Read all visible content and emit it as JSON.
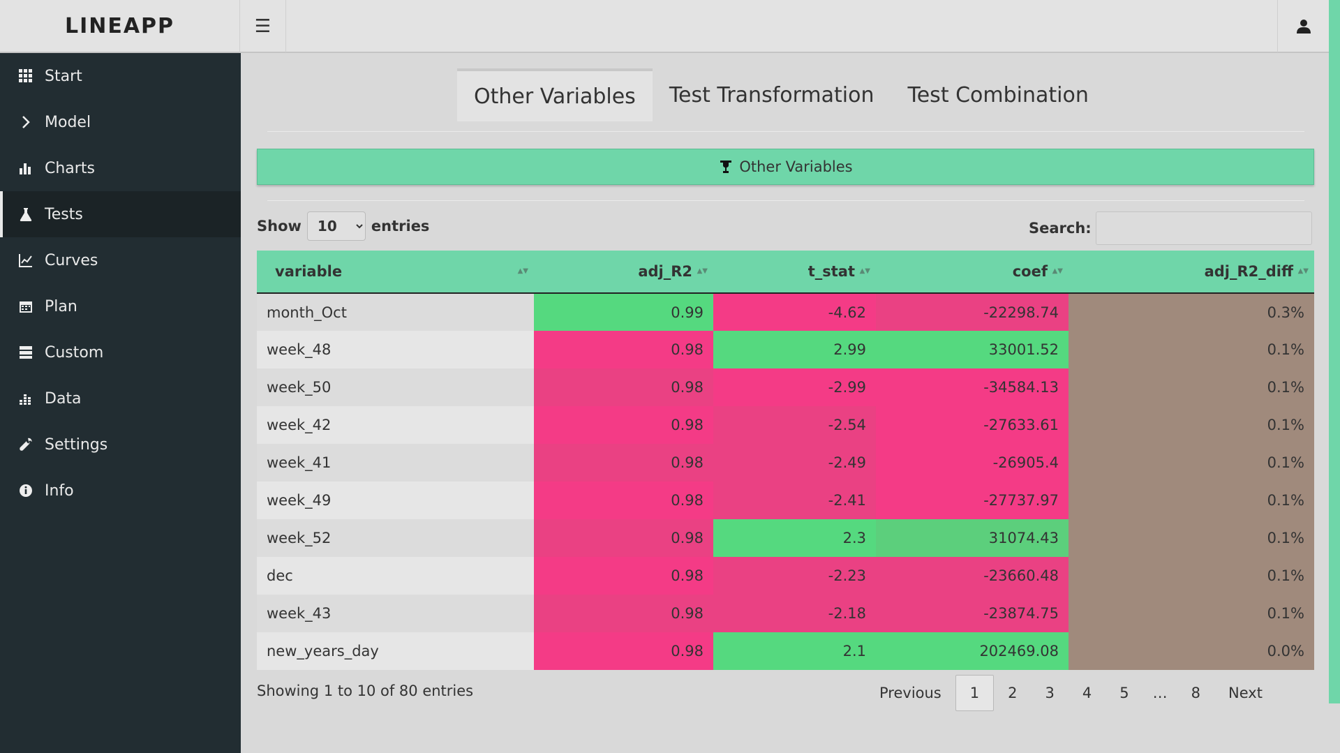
{
  "app": {
    "brand": "LINEAPP"
  },
  "header": {
    "menu_icon": "hamburger-icon",
    "user_icon": "user-icon"
  },
  "sidebar": {
    "items": [
      {
        "label": "Start",
        "icon": "grid-icon"
      },
      {
        "label": "Model",
        "icon": "chevron-right-icon"
      },
      {
        "label": "Charts",
        "icon": "bar-chart-icon"
      },
      {
        "label": "Tests",
        "icon": "flask-icon",
        "active": true
      },
      {
        "label": "Curves",
        "icon": "line-chart-icon"
      },
      {
        "label": "Plan",
        "icon": "calendar-icon"
      },
      {
        "label": "Custom",
        "icon": "server-icon"
      },
      {
        "label": "Data",
        "icon": "data-bars-icon"
      },
      {
        "label": "Settings",
        "icon": "wrench-icon"
      },
      {
        "label": "Info",
        "icon": "info-icon"
      }
    ]
  },
  "tabs": [
    "Other Variables",
    "Test Transformation",
    "Test Combination"
  ],
  "banner": {
    "label": "Other Variables",
    "icon": "trophy-icon"
  },
  "controls": {
    "show_label": "Show",
    "entries_label": "entries",
    "page_size": "10",
    "search_label": "Search:",
    "search_value": ""
  },
  "table": {
    "headers": [
      "variable",
      "adj_R2",
      "t_stat",
      "coef",
      "adj_R2_diff"
    ],
    "rows": [
      {
        "variable": "month_Oct",
        "adj_R2": "0.99",
        "t_stat": "-4.62",
        "coef": "-22298.74",
        "adj_R2_diff": "0.3%"
      },
      {
        "variable": "week_48",
        "adj_R2": "0.98",
        "t_stat": "2.99",
        "coef": "33001.52",
        "adj_R2_diff": "0.1%"
      },
      {
        "variable": "week_50",
        "adj_R2": "0.98",
        "t_stat": "-2.99",
        "coef": "-34584.13",
        "adj_R2_diff": "0.1%"
      },
      {
        "variable": "week_42",
        "adj_R2": "0.98",
        "t_stat": "-2.54",
        "coef": "-27633.61",
        "adj_R2_diff": "0.1%"
      },
      {
        "variable": "week_41",
        "adj_R2": "0.98",
        "t_stat": "-2.49",
        "coef": "-26905.4",
        "adj_R2_diff": "0.1%"
      },
      {
        "variable": "week_49",
        "adj_R2": "0.98",
        "t_stat": "-2.41",
        "coef": "-27737.97",
        "adj_R2_diff": "0.1%"
      },
      {
        "variable": "week_52",
        "adj_R2": "0.98",
        "t_stat": "2.3",
        "coef": "31074.43",
        "adj_R2_diff": "0.1%"
      },
      {
        "variable": "dec",
        "adj_R2": "0.98",
        "t_stat": "-2.23",
        "coef": "-23660.48",
        "adj_R2_diff": "0.1%"
      },
      {
        "variable": "week_43",
        "adj_R2": "0.98",
        "t_stat": "-2.18",
        "coef": "-23874.75",
        "adj_R2_diff": "0.1%"
      },
      {
        "variable": "new_years_day",
        "adj_R2": "0.98",
        "t_stat": "2.1",
        "coef": "202469.08",
        "adj_R2_diff": "0.0%"
      }
    ]
  },
  "footer": {
    "info": "Showing 1 to 10 of 80 entries",
    "pagination": [
      "Previous",
      "1",
      "2",
      "3",
      "4",
      "5",
      "…",
      "8",
      "Next"
    ],
    "current_page": "1"
  },
  "colors": {
    "accent_green": "#6fd6a9",
    "cell_green": "#55d97f",
    "cell_green_soft": "#5ccf7c",
    "cell_pink": "#f43b86",
    "cell_pink_soft": "#ea4183",
    "cell_brown": "#a08a7c",
    "sidebar_bg": "#222d32"
  }
}
